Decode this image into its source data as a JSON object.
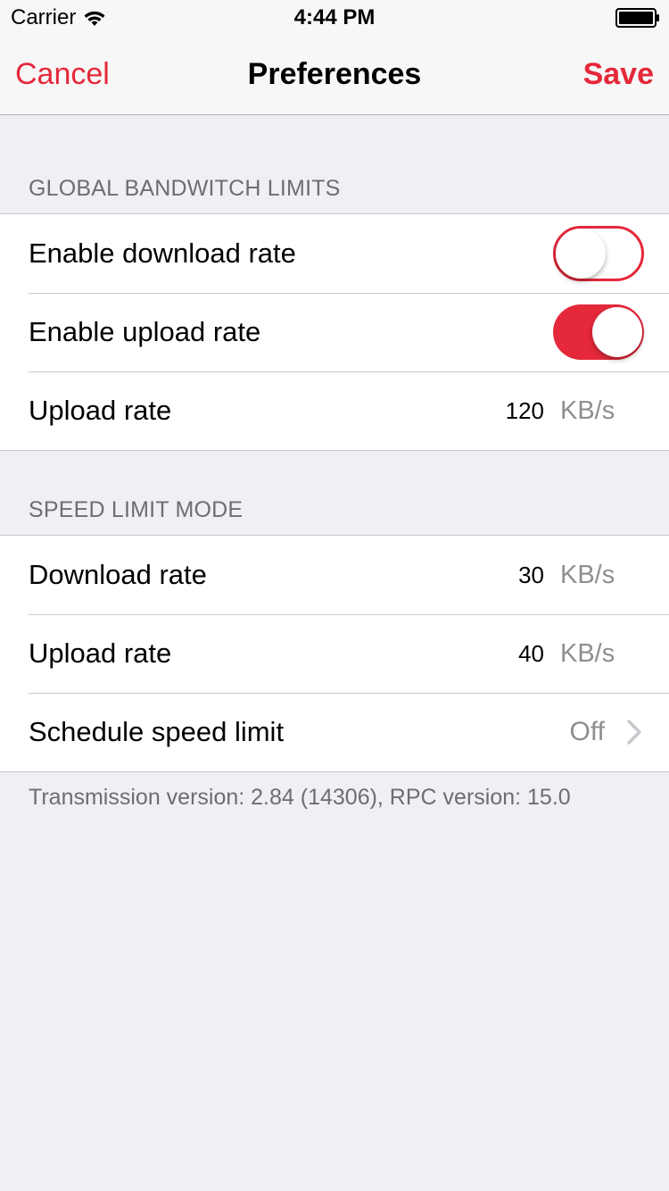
{
  "status_bar": {
    "carrier": "Carrier",
    "time": "4:44 PM",
    "wifi_icon": "wifi-icon",
    "battery_icon": "battery-icon"
  },
  "nav": {
    "cancel_label": "Cancel",
    "title": "Preferences",
    "save_label": "Save",
    "accent_color": "#e5283a"
  },
  "sections": [
    {
      "header": "GLOBAL BANDWITCH LIMITS",
      "rows": [
        {
          "label": "Enable download rate",
          "type": "toggle",
          "on": false
        },
        {
          "label": "Enable upload rate",
          "type": "toggle",
          "on": true
        },
        {
          "label": "Upload rate",
          "type": "value",
          "value": "120",
          "unit": "KB/s"
        }
      ]
    },
    {
      "header": "SPEED LIMIT MODE",
      "rows": [
        {
          "label": "Download rate",
          "type": "value",
          "value": "30",
          "unit": "KB/s"
        },
        {
          "label": "Upload rate",
          "type": "value",
          "value": "40",
          "unit": "KB/s"
        },
        {
          "label": "Schedule speed limit",
          "type": "disclosure",
          "detail": "Off",
          "icon": "chevron-right-icon"
        }
      ]
    }
  ],
  "footer": "Transmission version: 2.84 (14306), RPC version: 15.0"
}
